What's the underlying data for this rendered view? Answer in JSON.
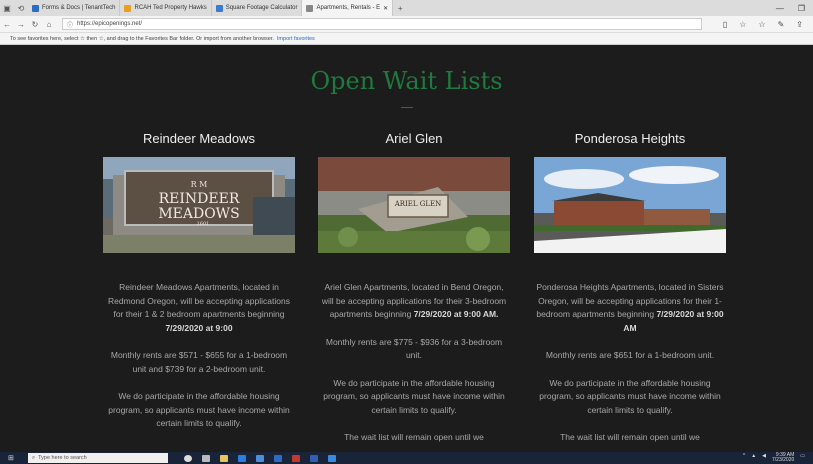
{
  "browser": {
    "tabs": [
      {
        "label": "Forms & Docs | TenantTech",
        "color": "#2b6cc4"
      },
      {
        "label": "RCAH Ted Property Hawks",
        "color": "#e8a020"
      },
      {
        "label": "Square Footage Calculator",
        "color": "#3a7bd5"
      },
      {
        "label": "Apartments, Rentals - E",
        "color": "#888888",
        "active": true
      }
    ],
    "new_tab": "+",
    "url": "https://epicopenings.net/",
    "favorites_hint": "To see favorites here, select ☆ then ☆, and drag to the Favorites Bar folder. Or import from another browser.",
    "import_link": "Import favorites"
  },
  "page": {
    "heading": "Open Wait Lists",
    "listings": [
      {
        "name": "Reindeer Meadows",
        "sign_line1": "REINDEER",
        "sign_line2": "MEADOWS",
        "sign_number": "1601",
        "p1_pre": "Reindeer Meadows Apartments, located in Redmond Oregon, will be accepting applications for their 1 & 2 bedroom apartments beginning ",
        "p1_bold": "7/29/2020 at 9:00",
        "p2": "Monthly rents are $571 - $655 for a 1-bedroom unit and $739 for a 2-bedroom unit.",
        "p3": "We do participate in the affordable housing program, so applicants must have income within certain limits to qualify.",
        "p4": ""
      },
      {
        "name": "Ariel Glen",
        "sign_line1": "ARIEL",
        "sign_line2": "GLEN",
        "sign_number": "",
        "p1_pre": "Ariel Glen Apartments, located in Bend Oregon, will be accepting applications for their 3-bedroom apartments beginning ",
        "p1_bold": "7/29/2020 at 9:00 AM.",
        "p2": "Monthly rents are $775 - $936 for a 3-bedroom unit.",
        "p3": "We do participate in the affordable housing program, so applicants must have income within certain limits to qualify.",
        "p4": "The wait list will remain open until we"
      },
      {
        "name": "Ponderosa Heights",
        "sign_line1": "",
        "sign_line2": "",
        "sign_number": "",
        "p1_pre": "Ponderosa Heights Apartments, located in Sisters Oregon, will be accepting applications for their 1-bedroom apartments beginning ",
        "p1_bold": "7/29/2020 at 9:00 AM",
        "p2": "Monthly rents are $651 for a 1-bedroom unit.",
        "p3": "We do participate in the affordable housing program, so applicants must have income within certain limits to qualify.",
        "p4": "The wait list will remain open until we"
      }
    ]
  },
  "taskbar": {
    "search_placeholder": "Type here to search",
    "clock_time": "9:39 AM",
    "clock_date": "7/23/2020"
  },
  "colors": {
    "heading": "#1f7a3d",
    "background": "#1c1c1c"
  }
}
